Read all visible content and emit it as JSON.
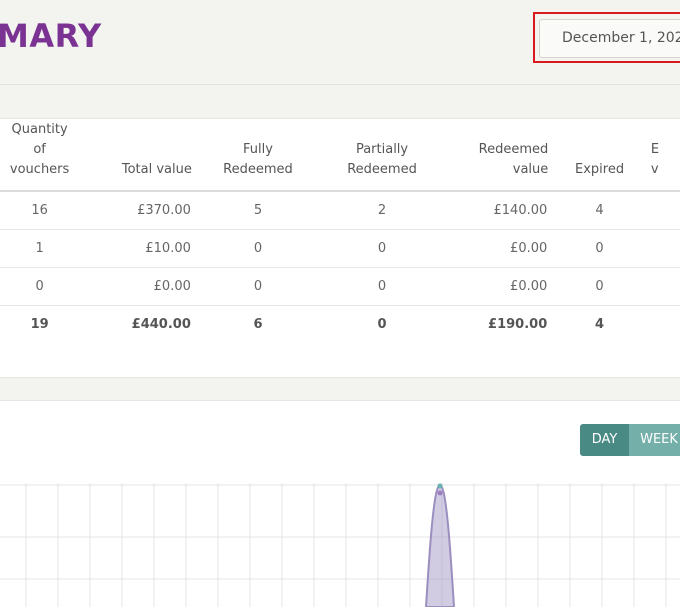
{
  "page": {
    "title": "MARY"
  },
  "date_picker": {
    "value": "December 1, 202"
  },
  "table": {
    "headers": [
      [
        "Quantity of",
        "vouchers"
      ],
      [
        "",
        "Total value"
      ],
      [
        "Fully",
        "Redeemed"
      ],
      [
        "Partially",
        "Redeemed"
      ],
      [
        "Redeemed",
        "value"
      ],
      [
        "",
        "Expired"
      ],
      [
        "E",
        "v"
      ]
    ],
    "rows": [
      [
        "16",
        "£370.00",
        "5",
        "2",
        "£140.00",
        "4",
        ""
      ],
      [
        "1",
        "£10.00",
        "0",
        "0",
        "£0.00",
        "0",
        ""
      ],
      [
        "0",
        "£0.00",
        "0",
        "0",
        "£0.00",
        "0",
        ""
      ]
    ],
    "total": [
      "19",
      "£440.00",
      "6",
      "0",
      "£190.00",
      "4",
      ""
    ]
  },
  "chart_controls": {
    "day": "DAY",
    "week": "WEEK"
  },
  "chart_data": {
    "type": "area",
    "series": [
      {
        "color": "#9b8fc0"
      }
    ],
    "grid": true,
    "peak_marker_colors": [
      "#6ab0b0",
      "#9b7fc0"
    ]
  }
}
